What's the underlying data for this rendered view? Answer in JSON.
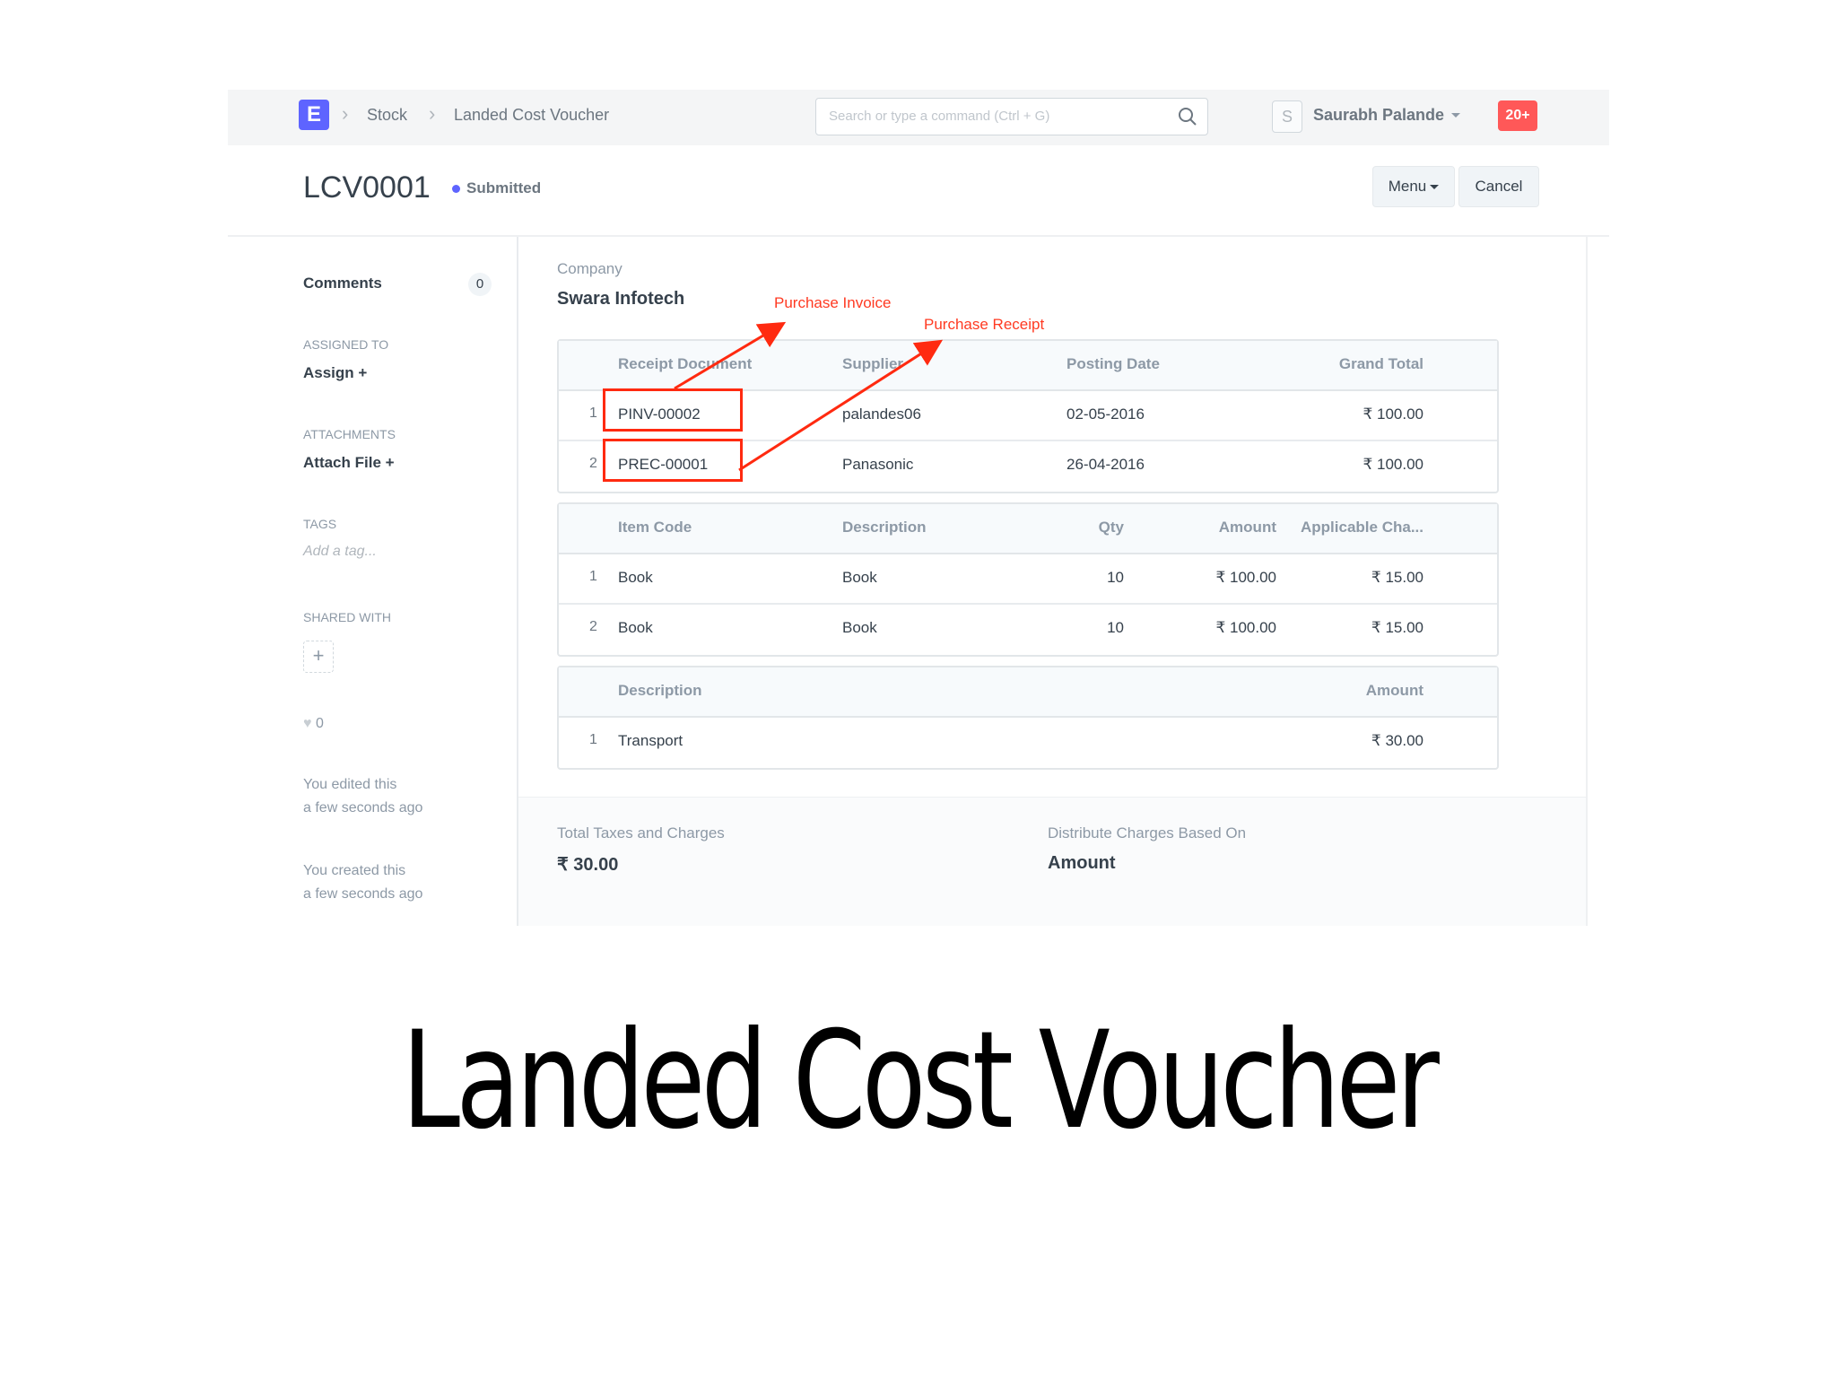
{
  "navbar": {
    "logo_letter": "E",
    "breadcrumbs": [
      "Stock",
      "Landed Cost Voucher"
    ],
    "search_placeholder": "Search or type a command (Ctrl + G)",
    "avatar_letter": "S",
    "user_name": "Saurabh Palande",
    "notifications": "20+"
  },
  "title_bar": {
    "doc_name": "LCV0001",
    "status": "Submitted",
    "menu_label": "Menu",
    "cancel_label": "Cancel"
  },
  "sidebar": {
    "comments_label": "Comments",
    "comments_count": "0",
    "assigned_to_heading": "ASSIGNED TO",
    "assign_label": "Assign +",
    "attachments_heading": "ATTACHMENTS",
    "attach_label": "Attach File +",
    "tags_heading": "TAGS",
    "tag_placeholder": "Add a tag...",
    "shared_heading": "SHARED WITH",
    "likes": "0",
    "edited_text": "You edited this",
    "edited_time": "a few seconds ago",
    "created_text": "You created this",
    "created_time": "a few seconds ago"
  },
  "form": {
    "company_label": "Company",
    "company_value": "Swara Infotech",
    "receipts_table": {
      "headers": [
        "Receipt Document",
        "Supplier",
        "Posting Date",
        "Grand Total"
      ],
      "rows": [
        {
          "idx": "1",
          "doc": "PINV-00002",
          "supplier": "palandes06",
          "date": "02-05-2016",
          "total": "₹ 100.00"
        },
        {
          "idx": "2",
          "doc": "PREC-00001",
          "supplier": "Panasonic",
          "date": "26-04-2016",
          "total": "₹ 100.00"
        }
      ]
    },
    "items_table": {
      "headers": [
        "Item Code",
        "Description",
        "Qty",
        "Amount",
        "Applicable Cha..."
      ],
      "rows": [
        {
          "idx": "1",
          "code": "Book",
          "desc": "Book",
          "qty": "10",
          "amount": "₹ 100.00",
          "charges": "₹ 15.00"
        },
        {
          "idx": "2",
          "code": "Book",
          "desc": "Book",
          "qty": "10",
          "amount": "₹ 100.00",
          "charges": "₹ 15.00"
        }
      ]
    },
    "taxes_table": {
      "headers": [
        "Description",
        "Amount"
      ],
      "rows": [
        {
          "idx": "1",
          "desc": "Transport",
          "amount": "₹ 30.00"
        }
      ]
    },
    "total_label": "Total Taxes and Charges",
    "total_value": "₹ 30.00",
    "distribute_label": "Distribute Charges Based On",
    "distribute_value": "Amount"
  },
  "annotations": {
    "purchase_invoice": "Purchase Invoice",
    "purchase_receipt": "Purchase Receipt",
    "color": "#ff2a10"
  },
  "caption": "Landed Cost Voucher"
}
